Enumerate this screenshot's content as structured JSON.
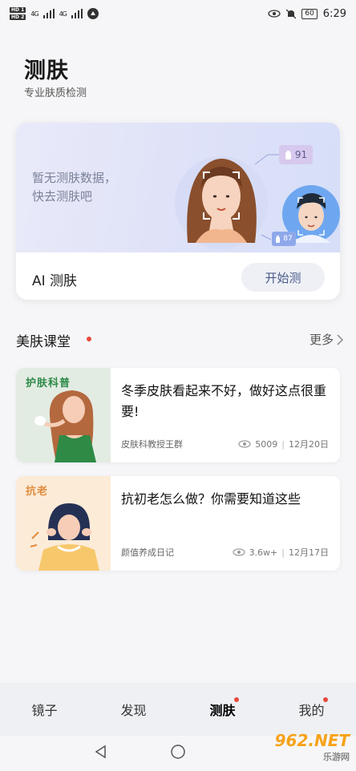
{
  "status_bar": {
    "hd1": "HD 1",
    "hd2": "HD 2",
    "network1": "4G",
    "network2": "4G",
    "battery": "60",
    "time": "6:29"
  },
  "header": {
    "title": "测肤",
    "subtitle": "专业肤质检测"
  },
  "ai_card": {
    "empty_text_line1": "暂无测肤数据，",
    "empty_text_line2": "快去测肤吧",
    "score_badge_1": "91",
    "score_badge_2": "87",
    "label": "AI 测肤",
    "start_button": "开始测"
  },
  "section": {
    "title": "美肤课堂",
    "more": "更多"
  },
  "articles": [
    {
      "tag": "护肤科普",
      "title": "冬季皮肤看起来不好，做好这点很重要!",
      "author": "皮肤科教授王群",
      "views": "5009",
      "date": "12月20日"
    },
    {
      "tag": "抗老",
      "title": "抗初老怎么做？你需要知道这些",
      "author": "颜值养成日记",
      "views": "3.6w+",
      "date": "12月17日"
    }
  ],
  "bottom_nav": {
    "items": [
      "镜子",
      "发现",
      "测肤",
      "我的"
    ]
  },
  "watermark": "962.NET",
  "watermark_sub": "乐游网",
  "colors": {
    "accent_red": "#e84a3b",
    "nav_bg": "#eef0f3",
    "hero_bg": "#e2e5f8"
  }
}
